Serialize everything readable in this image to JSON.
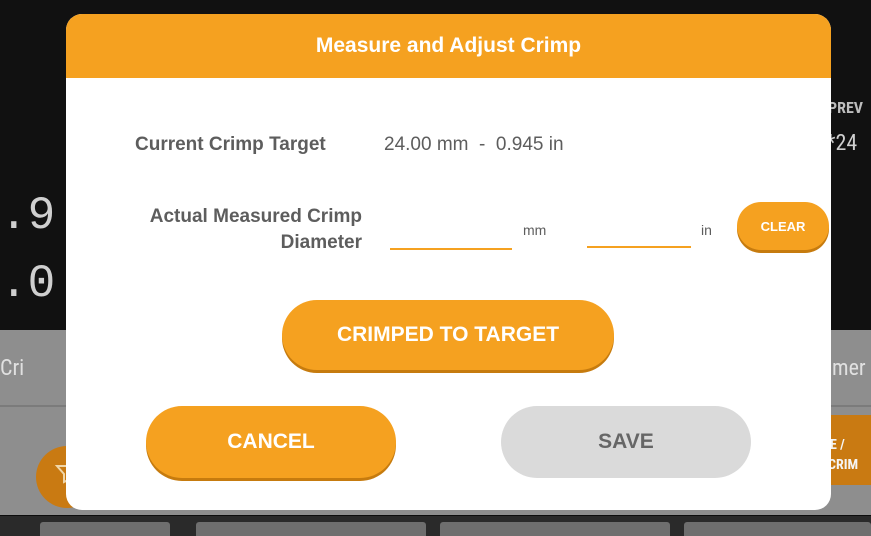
{
  "background": {
    "prev_label": "PREV",
    "prev_value": "*24",
    "left_value_1": ".9",
    "left_value_2": ".0",
    "left_text": "Cri",
    "right_text": "mer",
    "right_button": [
      "E /",
      "CRIM"
    ]
  },
  "dialog": {
    "title": "Measure and Adjust Crimp",
    "current_target_label": "Current Crimp Target",
    "current_target_value": "24.00 mm  -  0.945 in",
    "measured_label_line1": "Actual Measured Crimp",
    "measured_label_line2": "Diameter",
    "mm_value": "",
    "in_value": "",
    "mm_unit": "mm",
    "in_unit": "in",
    "clear_label": "CLEAR",
    "crimped_label": "CRIMPED TO TARGET",
    "cancel_label": "CANCEL",
    "save_label": "SAVE"
  },
  "colors": {
    "accent": "#f5a120",
    "disabled": "#dadada"
  }
}
